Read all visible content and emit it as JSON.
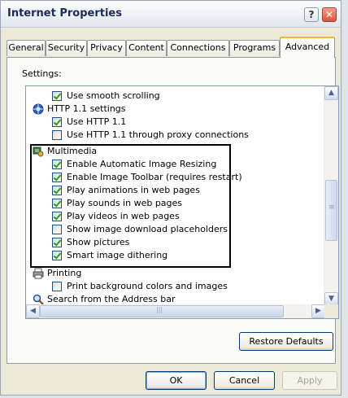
{
  "window": {
    "title": "Internet Properties",
    "help_glyph": "?",
    "close_glyph": "✕"
  },
  "tabs": [
    "General",
    "Security",
    "Privacy",
    "Content",
    "Connections",
    "Programs",
    "Advanced"
  ],
  "active_tab": "Advanced",
  "settings_label": "Settings:",
  "items": {
    "smooth_scrolling": {
      "label": "Use smooth scrolling",
      "checked": true
    },
    "http11_group": "HTTP 1.1 settings",
    "use_http11": {
      "label": "Use HTTP 1.1",
      "checked": true
    },
    "use_http11_proxy": {
      "label": "Use HTTP 1.1 through proxy connections",
      "checked": false
    },
    "multimedia_group": "Multimedia",
    "auto_resize": {
      "label": "Enable Automatic Image Resizing",
      "checked": true
    },
    "image_toolbar": {
      "label": "Enable Image Toolbar (requires restart)",
      "checked": true
    },
    "play_animations": {
      "label": "Play animations in web pages",
      "checked": true
    },
    "play_sounds": {
      "label": "Play sounds in web pages",
      "checked": true
    },
    "play_videos": {
      "label": "Play videos in web pages",
      "checked": true
    },
    "download_placeholders": {
      "label": "Show image download placeholders",
      "checked": false
    },
    "show_pictures": {
      "label": "Show pictures",
      "checked": true
    },
    "smart_dithering": {
      "label": "Smart image dithering",
      "checked": true
    },
    "printing_group": "Printing",
    "print_background": {
      "label": "Print background colors and images",
      "checked": false
    },
    "search_group": "Search from the Address bar"
  },
  "scroll": {
    "up": "▲",
    "down": "▼",
    "left": "◀",
    "right": "▶",
    "grip": "≡",
    "hgrip": "|||"
  },
  "buttons": {
    "restore": "Restore Defaults",
    "ok": "OK",
    "cancel": "Cancel",
    "apply": "Apply"
  },
  "icons": {
    "http": "globe-gear-icon",
    "multimedia": "multimedia-icon",
    "printing": "printer-icon",
    "search": "magnifier-icon"
  },
  "colors": {
    "check": "#21a121",
    "border_blue": "#003c74"
  }
}
